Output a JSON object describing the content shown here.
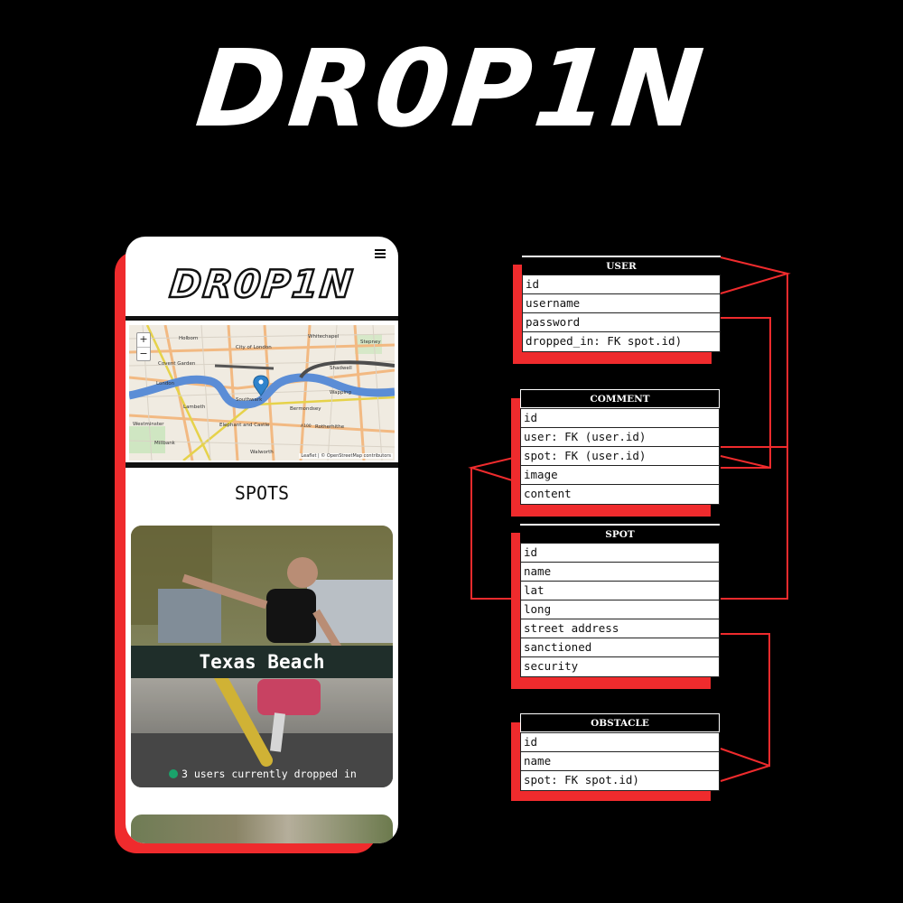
{
  "brand": {
    "logo_text": "DR0P1N"
  },
  "app": {
    "logo_text": "DR0P1N",
    "menu_icon": "hamburger-menu-icon",
    "map": {
      "zoom_in": "+",
      "zoom_out": "−",
      "attribution": "Leaflet | © OpenStreetMap contributors",
      "labels": [
        "Holborn",
        "City of London",
        "Whitechapel",
        "Stepney",
        "Covent Garden",
        "Shadwell",
        "London",
        "Southwark",
        "Wapping",
        "Lambeth",
        "Bermondsey",
        "Westminster",
        "Elephant and Castle",
        "Rotherhithe",
        "Millbank",
        "Walworth",
        "A100"
      ],
      "marker_icon": "map-pin-icon"
    },
    "section_title": "SPOTS",
    "spots": [
      {
        "name": "Texas Beach",
        "status": "3 users currently dropped in",
        "status_color": "#1aa36b"
      }
    ]
  },
  "schema": {
    "tables": [
      {
        "name": "USER",
        "fields": [
          "id",
          "username",
          "password",
          "dropped_in: FK spot.id)"
        ]
      },
      {
        "name": "COMMENT",
        "fields": [
          "id",
          "user: FK (user.id)",
          "spot: FK (user.id)",
          "image",
          "content"
        ]
      },
      {
        "name": "SPOT",
        "fields": [
          "id",
          "name",
          "lat",
          "long",
          "street address",
          "sanctioned",
          "security"
        ]
      },
      {
        "name": "OBSTACLE",
        "fields": [
          "id",
          "name",
          "spot: FK spot.id)"
        ]
      }
    ]
  },
  "colors": {
    "accent": "#ef2b2d",
    "background": "#000000",
    "card_label_bg": "#1f2e2a"
  }
}
